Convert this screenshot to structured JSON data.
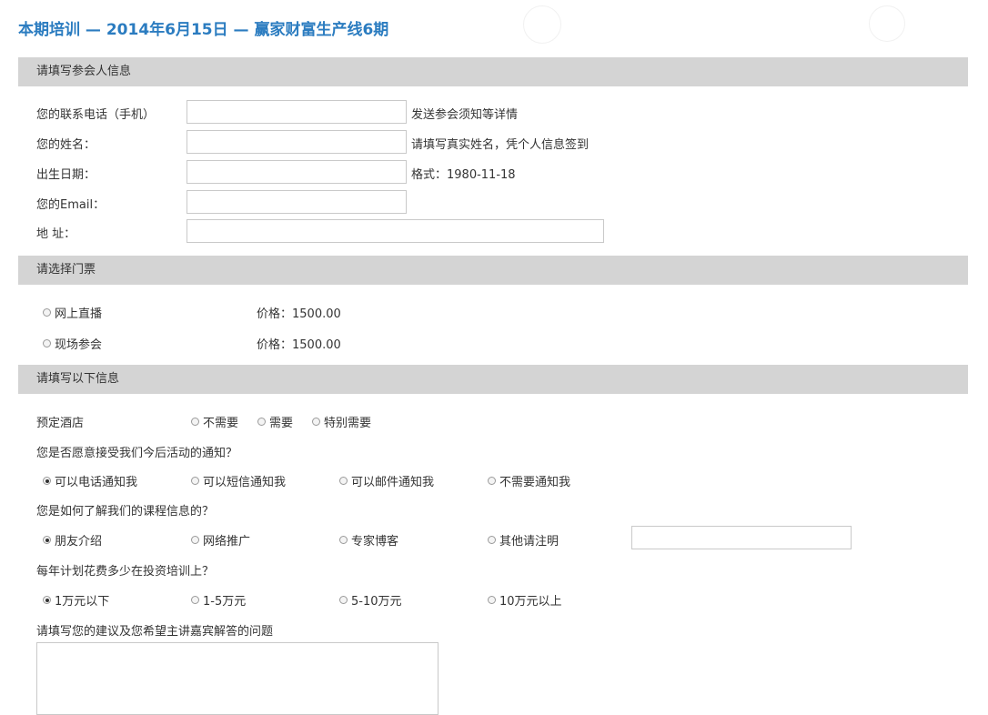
{
  "header": {
    "title": "本期培训 — 2014年6月15日 — 赢家财富生产线6期"
  },
  "attendee": {
    "section_title": "请填写参会人信息",
    "phone_label": "您的联系电话（手机）",
    "phone_value": "",
    "phone_hint": "发送参会须知等详情",
    "name_label": "您的姓名：",
    "name_value": "",
    "name_hint": "请填写真实姓名，凭个人信息签到",
    "birth_label": "出生日期：",
    "birth_value": "",
    "birth_hint": "格式：1980-11-18",
    "email_label": "您的Email：",
    "email_value": "",
    "address_label": "地 址：",
    "address_value": ""
  },
  "tickets": {
    "section_title": "请选择门票",
    "items": [
      {
        "label": "网上直播",
        "price": "价格：1500.00",
        "selected": false
      },
      {
        "label": "现场参会",
        "price": "价格：1500.00",
        "selected": false
      }
    ]
  },
  "extra": {
    "section_title": "请填写以下信息",
    "hotel": {
      "label": "预定酒店",
      "options": [
        {
          "label": "不需要",
          "selected": false
        },
        {
          "label": "需要",
          "selected": false
        },
        {
          "label": "特别需要",
          "selected": false
        }
      ]
    },
    "notify": {
      "question": "您是否愿意接受我们今后活动的通知？",
      "options": [
        {
          "label": "可以电话通知我",
          "selected": true
        },
        {
          "label": "可以短信通知我",
          "selected": false
        },
        {
          "label": "可以邮件通知我",
          "selected": false
        },
        {
          "label": "不需要通知我",
          "selected": false
        }
      ]
    },
    "source": {
      "question": "您是如何了解我们的课程信息的？",
      "options": [
        {
          "label": "朋友介绍",
          "selected": true
        },
        {
          "label": "网络推广",
          "selected": false
        },
        {
          "label": "专家博客",
          "selected": false
        },
        {
          "label": "其他请注明",
          "selected": false
        }
      ],
      "other_value": ""
    },
    "budget": {
      "question": "每年计划花费多少在投资培训上？",
      "options": [
        {
          "label": "1万元以下",
          "selected": true
        },
        {
          "label": "1-5万元",
          "selected": false
        },
        {
          "label": "5-10万元",
          "selected": false
        },
        {
          "label": "10万元以上",
          "selected": false
        }
      ]
    },
    "suggestion": {
      "label": "请填写您的建议及您希望主讲嘉宾解答的问题",
      "value": ""
    }
  }
}
